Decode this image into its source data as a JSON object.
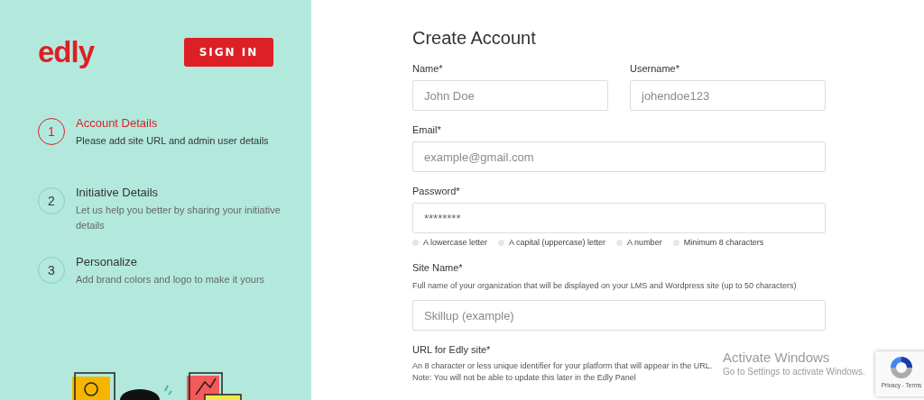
{
  "brand": {
    "logo": "edly"
  },
  "sign_in_button": "SIGN IN",
  "steps": [
    {
      "number": "1",
      "title": "Account Details",
      "description": "Please add site URL and admin user details",
      "selected": true
    },
    {
      "number": "2",
      "title": "Initiative Details",
      "description": "Let us help you better by sharing your initiative details",
      "selected": false
    },
    {
      "number": "3",
      "title": "Personalize",
      "description": "Add brand colors and logo to make it yours",
      "selected": false
    }
  ],
  "form": {
    "title": "Create Account",
    "name": {
      "label": "Name*",
      "placeholder": "John Doe"
    },
    "username": {
      "label": "Username*",
      "placeholder": "johendoe123"
    },
    "email": {
      "label": "Email*",
      "placeholder": "example@gmail.com"
    },
    "password": {
      "label": "Password*",
      "value": "********"
    },
    "password_rules": [
      {
        "text": "A lowercase letter",
        "checked": false
      },
      {
        "text": "A capital (uppercase) letter",
        "checked": false
      },
      {
        "text": "A number",
        "checked": false
      },
      {
        "text": "Minimum 8 characters",
        "checked": false
      }
    ],
    "site_name": {
      "label": "Site Name*",
      "description": "Full name of your organization that will be displayed on your LMS and Wordpress site (up to 50 characters)",
      "placeholder": "Skillup (example)"
    },
    "site_url": {
      "label": "URL for Edly site*",
      "description": "An 8 character or less unique identifier for your platform that will appear in the URL. Note: You will not be able to update this later in the Edly Panel"
    }
  },
  "recaptcha": {
    "links": "Privacy - Terms"
  },
  "os_notice": {
    "title": "Activate Windows",
    "subtitle": "Go to Settings to activate Windows."
  }
}
